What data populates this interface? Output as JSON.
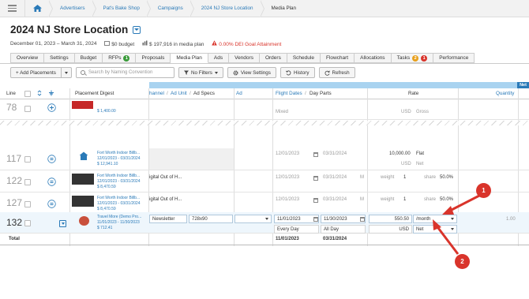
{
  "breadcrumb": {
    "items": [
      "Advertisers",
      "Pat's Bake Shop",
      "Campaigns",
      "2024 NJ Store Location",
      "Media Plan"
    ]
  },
  "header": {
    "title": "2024 NJ Store Location",
    "date_range": "December 01, 2023 – March 31, 2024",
    "budget": "$0 budget",
    "media_plan": "$ 197,916 in media plan",
    "dei_warning": "0.00% DEI Goal Attainment"
  },
  "tabs": [
    {
      "label": "Overview"
    },
    {
      "label": "Settings"
    },
    {
      "label": "Budget"
    },
    {
      "label": "RFPs",
      "badge": "1"
    },
    {
      "label": "Proposals"
    },
    {
      "label": "Media Plan",
      "active": true
    },
    {
      "label": "Ads"
    },
    {
      "label": "Vendors"
    },
    {
      "label": "Orders"
    },
    {
      "label": "Schedule"
    },
    {
      "label": "Flowchart"
    },
    {
      "label": "Allocations"
    },
    {
      "label": "Tasks",
      "badges": [
        "2",
        "1"
      ]
    },
    {
      "label": "Performance"
    }
  ],
  "toolbar": {
    "add_placements": "+ Add Placements",
    "search_placeholder": "Search by Naming Convention",
    "filters": "No Filters",
    "view_settings": "View Settings",
    "history": "History",
    "refresh": "Refresh"
  },
  "table": {
    "net_label": "Net",
    "headers": {
      "line": "Line",
      "placement_digest": "Placement Digest",
      "channel": "hannel",
      "ad_unit": "Ad Unit",
      "ad_specs": "Ad Specs",
      "ad": "Ad",
      "flight_dates": "Flight Dates",
      "day_parts": "Day Parts",
      "rate": "Rate",
      "quantity": "Quantity"
    },
    "rows": [
      {
        "line": "78",
        "digest": [
          "$ 1,400.00"
        ],
        "flight_mixed": "Mixed",
        "rate_usd": "USD",
        "rate_gross": "Gross"
      },
      {
        "line": "117",
        "digest": [
          "Fort Worth Indoor Billb...",
          "12/01/2023 - 03/31/2024",
          "$ 12,941.10"
        ],
        "start": "12/01/2023",
        "end": "03/31/2024",
        "rate": "10,000.00",
        "rate_type": "Flat",
        "usd": "USD",
        "net": "Net"
      },
      {
        "line": "122",
        "digest": [
          "Fort Worth Indoor Billb...",
          "12/01/2023 - 03/31/2024",
          "$ 8,470.59"
        ],
        "channel": "igital Out of H...",
        "start": "12/01/2023",
        "end": "03/31/2024",
        "m": "M",
        "weight": "weight",
        "weight_val": "1",
        "share": "share",
        "share_val": "50.0%"
      },
      {
        "line": "127",
        "digest": [
          "Fort Worth Indoor Billb...",
          "12/01/2023 - 03/31/2024",
          "$ 8,470.59"
        ],
        "channel": "igital Out of H...",
        "start": "12/01/2023",
        "end": "03/31/2024",
        "m": "M",
        "weight": "weight",
        "weight_val": "1",
        "share": "share",
        "share_val": "50.0%"
      },
      {
        "line": "132",
        "digest": [
          "Travel More (Demo Pro...",
          "11/01/2023 - 11/30/2023",
          "$ 712.41"
        ],
        "channel": "Newsletter",
        "ad_specs": "728x90",
        "start": "11/01/2023",
        "end": "11/30/2023",
        "day_from": "Every Day",
        "day_to": "All Day",
        "m": "M",
        "rate": "550.50",
        "rate_unit": "/month",
        "usd": "USD",
        "net": "Net",
        "quantity": "1.00"
      }
    ],
    "total_label": "Total",
    "total_start": "11/01/2023",
    "total_end": "03/31/2024"
  },
  "annotations": [
    "1",
    "2"
  ],
  "colors": {
    "accent": "#2a7ab8",
    "warning": "#d9342b",
    "annotation": "#d9342b",
    "header_band": "#a9d3f0"
  }
}
